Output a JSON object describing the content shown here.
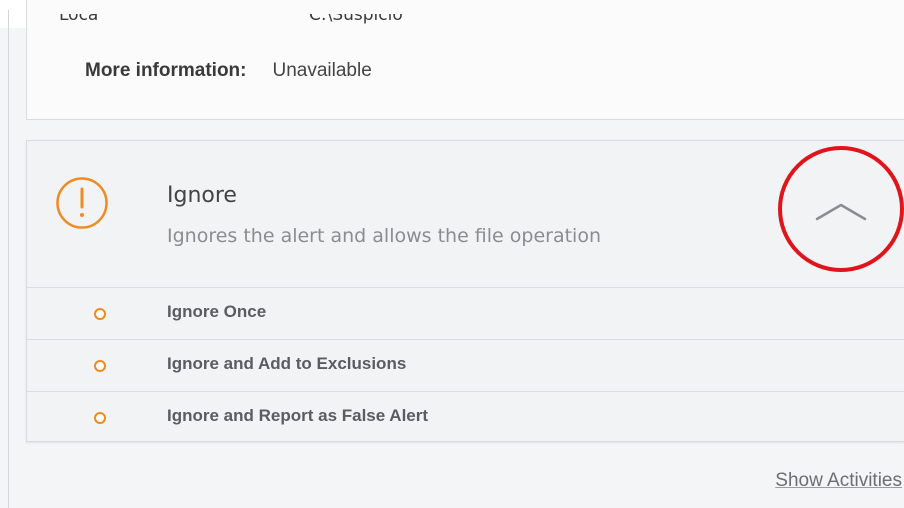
{
  "info_panel": {
    "partial_top_text_left": "Loca",
    "partial_top_text_right": "C:\\Suspicio",
    "more_info_label": "More information:",
    "more_info_value": "Unavailable"
  },
  "action": {
    "icon": "exclamation-circle-icon",
    "title": "Ignore",
    "description": "Ignores the alert and allows the file operation",
    "collapse_icon": "chevron-up-icon",
    "options": [
      {
        "label": "Ignore Once"
      },
      {
        "label": "Ignore and Add to Exclusions"
      },
      {
        "label": "Ignore and Report as False Alert"
      }
    ]
  },
  "footer": {
    "show_activities": "Show Activities"
  },
  "colors": {
    "accent_orange": "#ef8b22",
    "highlight_red": "#e0141b",
    "text_dark": "#3a3a3a",
    "text_muted": "#8a8c8f"
  }
}
